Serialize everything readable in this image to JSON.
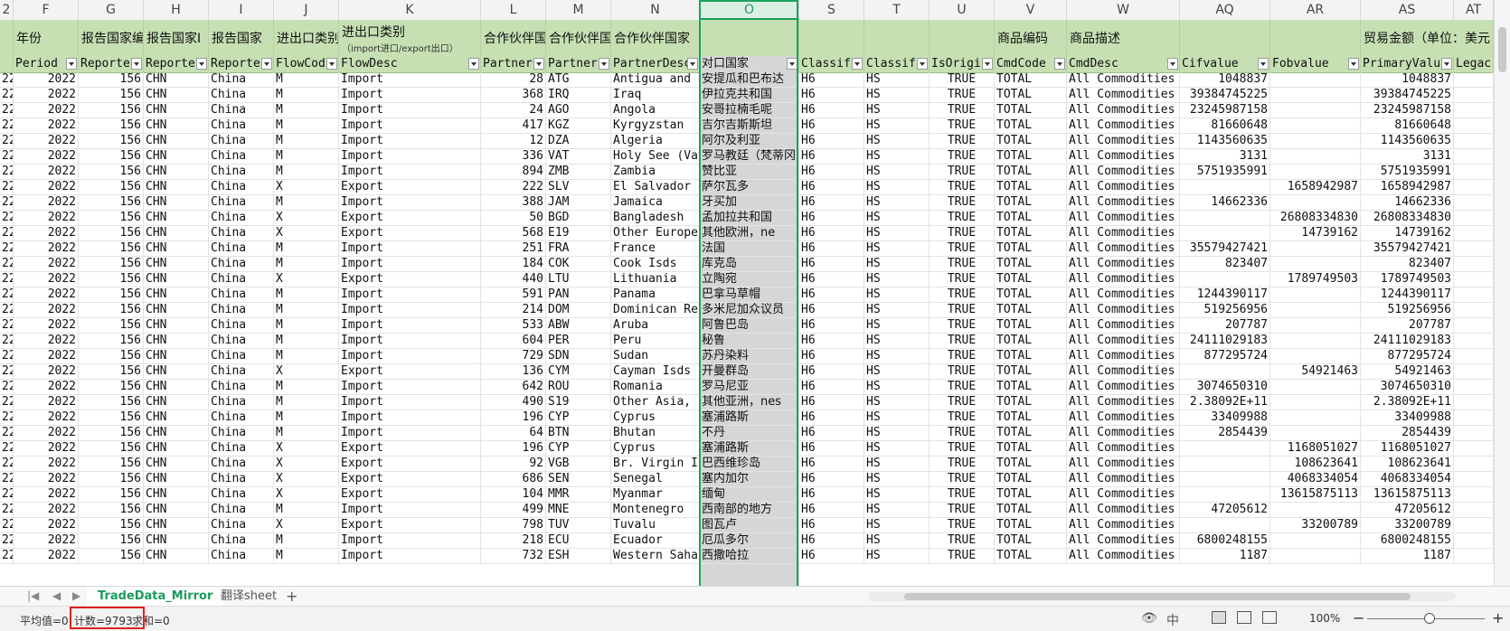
{
  "column_letters": [
    "2",
    "F",
    "G",
    "H",
    "I",
    "J",
    "K",
    "L",
    "M",
    "N",
    "O",
    "S",
    "T",
    "U",
    "V",
    "W",
    "AQ",
    "AR",
    "AS",
    "AT"
  ],
  "title_row": {
    "F": "年份",
    "G": "报告国家编",
    "H": "报告国家I",
    "I": "报告国家",
    "J": "进出口类别",
    "K": "进出口类别",
    "K_sub": "（import进口/export出口）",
    "L": "合作伙伴国",
    "M": "合作伙伴国",
    "N": "合作伙伴国家",
    "V": "商品编码",
    "W": "商品描述",
    "AS": "贸易金额（单位：美元"
  },
  "field_row": [
    "",
    "Period",
    "Reporter",
    "Reporter",
    "Reporter",
    "FlowCod",
    "FlowDesc",
    "Partner",
    "Partner",
    "PartnerDesc",
    "对口国家",
    "Classif",
    "Classif",
    "IsOrigi",
    "CmdCode",
    "CmdDesc",
    "Cifvalue",
    "Fobvalue",
    "PrimaryValu",
    "Legac"
  ],
  "rows": [
    [
      "22",
      "2022",
      "156",
      "CHN",
      "China",
      "M",
      "Import",
      "28",
      "ATG",
      "Antigua and Barbuda",
      "安提瓜和巴布达",
      "H6",
      "HS",
      "TRUE",
      "TOTAL",
      "All Commodities",
      "1048837",
      "",
      "1048837"
    ],
    [
      "22",
      "2022",
      "156",
      "CHN",
      "China",
      "M",
      "Import",
      "368",
      "IRQ",
      "Iraq",
      "伊拉克共和国",
      "H6",
      "HS",
      "TRUE",
      "TOTAL",
      "All Commodities",
      "39384745225",
      "",
      "39384745225"
    ],
    [
      "22",
      "2022",
      "156",
      "CHN",
      "China",
      "M",
      "Import",
      "24",
      "AGO",
      "Angola",
      "安哥拉楠毛呢",
      "H6",
      "HS",
      "TRUE",
      "TOTAL",
      "All Commodities",
      "23245987158",
      "",
      "23245987158"
    ],
    [
      "22",
      "2022",
      "156",
      "CHN",
      "China",
      "M",
      "Import",
      "417",
      "KGZ",
      "Kyrgyzstan",
      "吉尔吉斯斯坦",
      "H6",
      "HS",
      "TRUE",
      "TOTAL",
      "All Commodities",
      "81660648",
      "",
      "81660648"
    ],
    [
      "22",
      "2022",
      "156",
      "CHN",
      "China",
      "M",
      "Import",
      "12",
      "DZA",
      "Algeria",
      "阿尔及利亚",
      "H6",
      "HS",
      "TRUE",
      "TOTAL",
      "All Commodities",
      "1143560635",
      "",
      "1143560635"
    ],
    [
      "22",
      "2022",
      "156",
      "CHN",
      "China",
      "M",
      "Import",
      "336",
      "VAT",
      "Holy See (Vatican)",
      "罗马教廷（梵蒂冈）",
      "H6",
      "HS",
      "TRUE",
      "TOTAL",
      "All Commodities",
      "3131",
      "",
      "3131"
    ],
    [
      "22",
      "2022",
      "156",
      "CHN",
      "China",
      "M",
      "Import",
      "894",
      "ZMB",
      "Zambia",
      "赞比亚",
      "H6",
      "HS",
      "TRUE",
      "TOTAL",
      "All Commodities",
      "5751935991",
      "",
      "5751935991"
    ],
    [
      "22",
      "2022",
      "156",
      "CHN",
      "China",
      "X",
      "Export",
      "222",
      "SLV",
      "El Salvador",
      "萨尔瓦多",
      "H6",
      "HS",
      "TRUE",
      "TOTAL",
      "All Commodities",
      "",
      "1658942987",
      "1658942987"
    ],
    [
      "22",
      "2022",
      "156",
      "CHN",
      "China",
      "M",
      "Import",
      "388",
      "JAM",
      "Jamaica",
      "牙买加",
      "H6",
      "HS",
      "TRUE",
      "TOTAL",
      "All Commodities",
      "14662336",
      "",
      "14662336"
    ],
    [
      "22",
      "2022",
      "156",
      "CHN",
      "China",
      "X",
      "Export",
      "50",
      "BGD",
      "Bangladesh",
      "孟加拉共和国",
      "H6",
      "HS",
      "TRUE",
      "TOTAL",
      "All Commodities",
      "",
      "26808334830",
      "26808334830"
    ],
    [
      "22",
      "2022",
      "156",
      "CHN",
      "China",
      "X",
      "Export",
      "568",
      "E19",
      "Other Europe, nes",
      "其他欧洲，ne",
      "H6",
      "HS",
      "TRUE",
      "TOTAL",
      "All Commodities",
      "",
      "14739162",
      "14739162"
    ],
    [
      "22",
      "2022",
      "156",
      "CHN",
      "China",
      "M",
      "Import",
      "251",
      "FRA",
      "France",
      "法国",
      "H6",
      "HS",
      "TRUE",
      "TOTAL",
      "All Commodities",
      "35579427421",
      "",
      "35579427421"
    ],
    [
      "22",
      "2022",
      "156",
      "CHN",
      "China",
      "M",
      "Import",
      "184",
      "COK",
      "Cook Isds",
      "库克岛",
      "H6",
      "HS",
      "TRUE",
      "TOTAL",
      "All Commodities",
      "823407",
      "",
      "823407"
    ],
    [
      "22",
      "2022",
      "156",
      "CHN",
      "China",
      "X",
      "Export",
      "440",
      "LTU",
      "Lithuania",
      "立陶宛",
      "H6",
      "HS",
      "TRUE",
      "TOTAL",
      "All Commodities",
      "",
      "1789749503",
      "1789749503"
    ],
    [
      "22",
      "2022",
      "156",
      "CHN",
      "China",
      "M",
      "Import",
      "591",
      "PAN",
      "Panama",
      "巴拿马草帽",
      "H6",
      "HS",
      "TRUE",
      "TOTAL",
      "All Commodities",
      "1244390117",
      "",
      "1244390117"
    ],
    [
      "22",
      "2022",
      "156",
      "CHN",
      "China",
      "M",
      "Import",
      "214",
      "DOM",
      "Dominican Rep.",
      "多米尼加众议员",
      "H6",
      "HS",
      "TRUE",
      "TOTAL",
      "All Commodities",
      "519256956",
      "",
      "519256956"
    ],
    [
      "22",
      "2022",
      "156",
      "CHN",
      "China",
      "M",
      "Import",
      "533",
      "ABW",
      "Aruba",
      "阿鲁巴岛",
      "H6",
      "HS",
      "TRUE",
      "TOTAL",
      "All Commodities",
      "207787",
      "",
      "207787"
    ],
    [
      "22",
      "2022",
      "156",
      "CHN",
      "China",
      "M",
      "Import",
      "604",
      "PER",
      "Peru",
      "秘鲁",
      "H6",
      "HS",
      "TRUE",
      "TOTAL",
      "All Commodities",
      "24111029183",
      "",
      "24111029183"
    ],
    [
      "22",
      "2022",
      "156",
      "CHN",
      "China",
      "M",
      "Import",
      "729",
      "SDN",
      "Sudan",
      "苏丹染料",
      "H6",
      "HS",
      "TRUE",
      "TOTAL",
      "All Commodities",
      "877295724",
      "",
      "877295724"
    ],
    [
      "22",
      "2022",
      "156",
      "CHN",
      "China",
      "X",
      "Export",
      "136",
      "CYM",
      "Cayman Isds",
      "开曼群岛",
      "H6",
      "HS",
      "TRUE",
      "TOTAL",
      "All Commodities",
      "",
      "54921463",
      "54921463"
    ],
    [
      "22",
      "2022",
      "156",
      "CHN",
      "China",
      "M",
      "Import",
      "642",
      "ROU",
      "Romania",
      "罗马尼亚",
      "H6",
      "HS",
      "TRUE",
      "TOTAL",
      "All Commodities",
      "3074650310",
      "",
      "3074650310"
    ],
    [
      "22",
      "2022",
      "156",
      "CHN",
      "China",
      "M",
      "Import",
      "490",
      "S19",
      "Other Asia, nes",
      "其他亚洲，nes",
      "H6",
      "HS",
      "TRUE",
      "TOTAL",
      "All Commodities",
      "2.38092E+11",
      "",
      "2.38092E+11"
    ],
    [
      "22",
      "2022",
      "156",
      "CHN",
      "China",
      "M",
      "Import",
      "196",
      "CYP",
      "Cyprus",
      "塞浦路斯",
      "H6",
      "HS",
      "TRUE",
      "TOTAL",
      "All Commodities",
      "33409988",
      "",
      "33409988"
    ],
    [
      "22",
      "2022",
      "156",
      "CHN",
      "China",
      "M",
      "Import",
      "64",
      "BTN",
      "Bhutan",
      "不丹",
      "H6",
      "HS",
      "TRUE",
      "TOTAL",
      "All Commodities",
      "2854439",
      "",
      "2854439"
    ],
    [
      "22",
      "2022",
      "156",
      "CHN",
      "China",
      "X",
      "Export",
      "196",
      "CYP",
      "Cyprus",
      "塞浦路斯",
      "H6",
      "HS",
      "TRUE",
      "TOTAL",
      "All Commodities",
      "",
      "1168051027",
      "1168051027"
    ],
    [
      "22",
      "2022",
      "156",
      "CHN",
      "China",
      "X",
      "Export",
      "92",
      "VGB",
      "Br. Virgin Isds",
      "巴西维珍岛",
      "H6",
      "HS",
      "TRUE",
      "TOTAL",
      "All Commodities",
      "",
      "108623641",
      "108623641"
    ],
    [
      "22",
      "2022",
      "156",
      "CHN",
      "China",
      "X",
      "Export",
      "686",
      "SEN",
      "Senegal",
      "塞内加尔",
      "H6",
      "HS",
      "TRUE",
      "TOTAL",
      "All Commodities",
      "",
      "4068334054",
      "4068334054"
    ],
    [
      "22",
      "2022",
      "156",
      "CHN",
      "China",
      "X",
      "Export",
      "104",
      "MMR",
      "Myanmar",
      "缅甸",
      "H6",
      "HS",
      "TRUE",
      "TOTAL",
      "All Commodities",
      "",
      "13615875113",
      "13615875113"
    ],
    [
      "22",
      "2022",
      "156",
      "CHN",
      "China",
      "M",
      "Import",
      "499",
      "MNE",
      "Montenegro",
      "西南部的地方",
      "H6",
      "HS",
      "TRUE",
      "TOTAL",
      "All Commodities",
      "47205612",
      "",
      "47205612"
    ],
    [
      "22",
      "2022",
      "156",
      "CHN",
      "China",
      "X",
      "Export",
      "798",
      "TUV",
      "Tuvalu",
      "图瓦卢",
      "H6",
      "HS",
      "TRUE",
      "TOTAL",
      "All Commodities",
      "",
      "33200789",
      "33200789"
    ],
    [
      "22",
      "2022",
      "156",
      "CHN",
      "China",
      "M",
      "Import",
      "218",
      "ECU",
      "Ecuador",
      "厄瓜多尔",
      "H6",
      "HS",
      "TRUE",
      "TOTAL",
      "All Commodities",
      "6800248155",
      "",
      "6800248155"
    ],
    [
      "22",
      "2022",
      "156",
      "CHN",
      "China",
      "M",
      "Import",
      "732",
      "ESH",
      "Western Sahara",
      "西撒哈拉",
      "H6",
      "HS",
      "TRUE",
      "TOTAL",
      "All Commodities",
      "1187",
      "",
      "1187"
    ]
  ],
  "sheet_tabs": [
    "TradeData_Mirror",
    "翻译sheet"
  ],
  "active_tab": "TradeData_Mirror",
  "add_sheet_label": "+",
  "status_bar": {
    "average": "平均值=0",
    "count": "计数=9793",
    "sum": "求和=0",
    "zoom": "100%",
    "zoom_minus": "−",
    "zoom_plus": "+"
  },
  "colors": {
    "header_green": "#c6e0b4",
    "selection_green": "#1ba35f",
    "active_tab": "#1a9b5a",
    "count_highlight": "#e02020"
  },
  "icons": [
    "eye-icon",
    "input-method-icon",
    "normal-view-icon",
    "page-layout-icon",
    "page-break-icon"
  ]
}
